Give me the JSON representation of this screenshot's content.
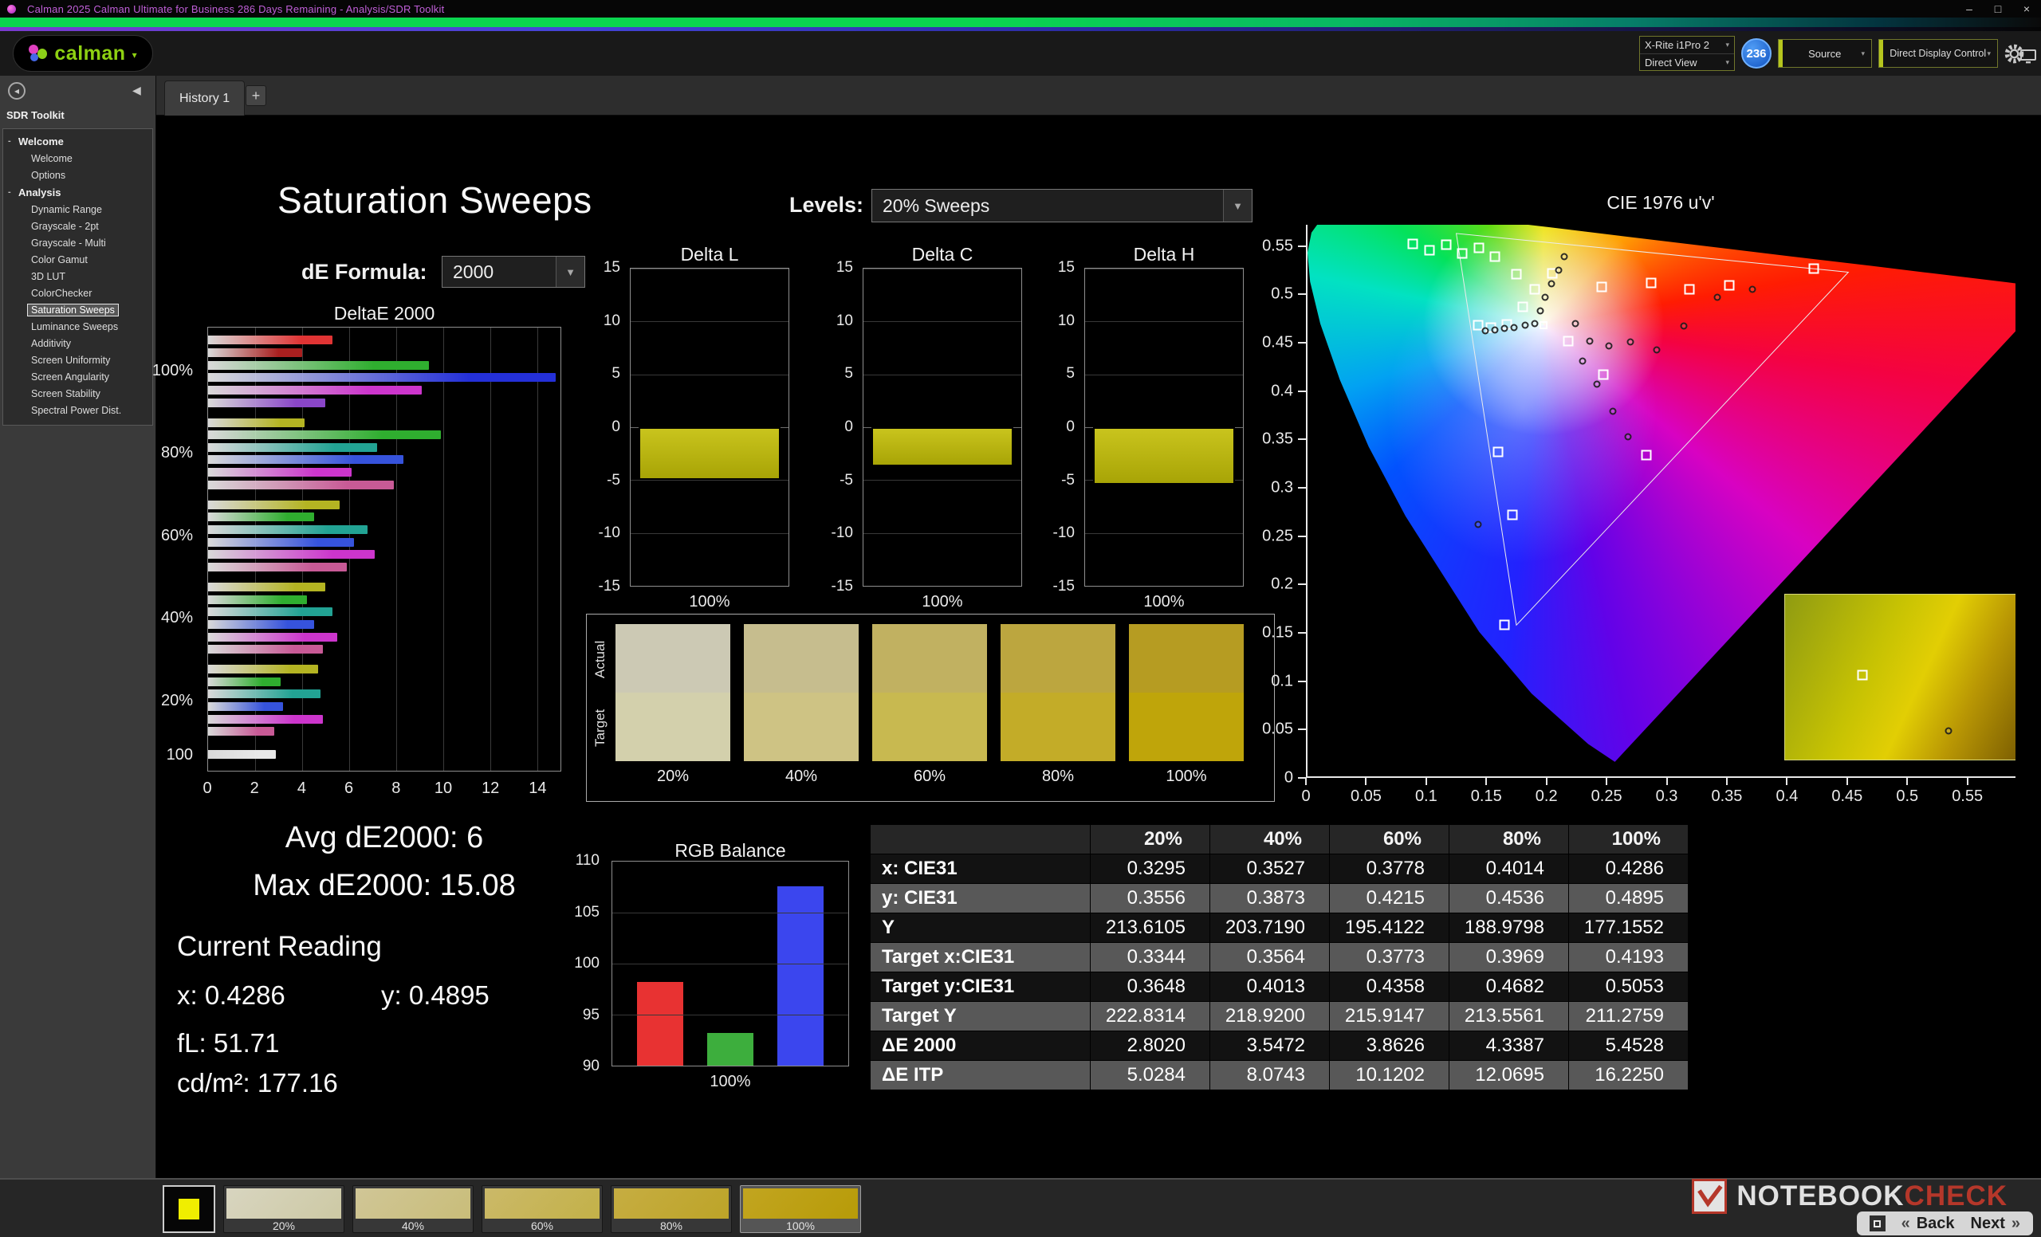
{
  "titlebar": {
    "title": "Calman 2025 Calman Ultimate for Business 286 Days Remaining  - Analysis/SDR Toolkit",
    "minimize": "–",
    "maximize": "□",
    "close": "×"
  },
  "icons": {
    "caret_down": "▼",
    "caret_small": "▾",
    "collapse_left": "◀",
    "plus": "+",
    "tree_expander": "-",
    "menu_dot": "◂",
    "back_arrow": "«",
    "next_arrow": "»"
  },
  "brand": {
    "name": "calman"
  },
  "toolbar": {
    "meter_line1": "X-Rite i1Pro 2",
    "meter_line2": "Direct View",
    "badge": "236",
    "source_label": "Source",
    "display_label": "Direct Display Control"
  },
  "tabs": {
    "history": "History 1"
  },
  "sidebar": {
    "title": "SDR Toolkit",
    "selected": "Saturation Sweeps",
    "groups": [
      {
        "label": "Welcome",
        "items": [
          "Welcome",
          "Options"
        ]
      },
      {
        "label": "Analysis",
        "items": [
          "Dynamic Range",
          "Grayscale - 2pt",
          "Grayscale - Multi",
          "Color Gamut",
          "3D LUT",
          "ColorChecker",
          "Saturation Sweeps",
          "Luminance Sweeps",
          "Additivity",
          "Screen Uniformity",
          "Screen Angularity",
          "Screen Stability",
          "Spectral Power Dist."
        ]
      }
    ]
  },
  "page": {
    "title": "Saturation Sweeps",
    "levels_label": "Levels:",
    "levels_value": "20% Sweeps",
    "formula_label": "dE Formula:",
    "formula_value": "2000"
  },
  "chart_data": [
    {
      "name": "deltae_2000",
      "type": "bar",
      "orientation": "horizontal",
      "title": "DeltaE 2000",
      "xlim": [
        0,
        15
      ],
      "xticks": [
        0,
        2,
        4,
        6,
        8,
        10,
        12,
        14
      ],
      "groups": [
        {
          "label": "100%",
          "bars": [
            {
              "color": "#e03434",
              "value": 5.3
            },
            {
              "color": "#aa1f1f",
              "value": 4.0
            },
            {
              "color": "#2fae2f",
              "value": 9.4
            },
            {
              "color": "#2430d8",
              "value": 14.8
            },
            {
              "color": "#cc35cc",
              "value": 9.1
            },
            {
              "color": "#8a46c8",
              "value": 5.0
            }
          ]
        },
        {
          "label": "80%",
          "bars": [
            {
              "color": "#b4b422",
              "value": 4.1
            },
            {
              "color": "#2fae2f",
              "value": 9.9
            },
            {
              "color": "#22a394",
              "value": 7.2
            },
            {
              "color": "#3653dc",
              "value": 8.3
            },
            {
              "color": "#cc35cc",
              "value": 6.1
            },
            {
              "color": "#c85a96",
              "value": 7.9
            }
          ]
        },
        {
          "label": "60%",
          "bars": [
            {
              "color": "#b4b422",
              "value": 5.6
            },
            {
              "color": "#2fae2f",
              "value": 4.5
            },
            {
              "color": "#22a394",
              "value": 6.8
            },
            {
              "color": "#3653dc",
              "value": 6.2
            },
            {
              "color": "#cc35cc",
              "value": 7.1
            },
            {
              "color": "#c85a96",
              "value": 5.9
            }
          ]
        },
        {
          "label": "40%",
          "bars": [
            {
              "color": "#b4b422",
              "value": 5.0
            },
            {
              "color": "#2fae2f",
              "value": 4.2
            },
            {
              "color": "#22a394",
              "value": 5.3
            },
            {
              "color": "#3653dc",
              "value": 4.5
            },
            {
              "color": "#cc35cc",
              "value": 5.5
            },
            {
              "color": "#c85a96",
              "value": 4.9
            }
          ]
        },
        {
          "label": "20%",
          "bars": [
            {
              "color": "#b4b422",
              "value": 4.7
            },
            {
              "color": "#2fae2f",
              "value": 3.1
            },
            {
              "color": "#22a394",
              "value": 4.8
            },
            {
              "color": "#3653dc",
              "value": 3.2
            },
            {
              "color": "#cc35cc",
              "value": 4.9
            },
            {
              "color": "#c85a96",
              "value": 2.8
            }
          ]
        },
        {
          "label": "100",
          "bars": [
            {
              "color": "#e8e8e8",
              "value": 2.9
            }
          ]
        }
      ]
    },
    {
      "name": "delta_l",
      "type": "bar",
      "title": "Delta L",
      "ylim": [
        -15,
        15
      ],
      "yticks": [
        15,
        10,
        5,
        0,
        -5,
        -10,
        -15
      ],
      "xlabel": "100%",
      "value": -5.0,
      "bar_color": "#c9c41d"
    },
    {
      "name": "delta_c",
      "type": "bar",
      "title": "Delta C",
      "ylim": [
        -15,
        15
      ],
      "yticks": [
        15,
        10,
        5,
        0,
        -5,
        -10,
        -15
      ],
      "xlabel": "100%",
      "value": -3.7,
      "bar_color": "#c9c41d"
    },
    {
      "name": "delta_h",
      "type": "bar",
      "title": "Delta H",
      "ylim": [
        -15,
        15
      ],
      "yticks": [
        15,
        10,
        5,
        0,
        -5,
        -10,
        -15
      ],
      "xlabel": "100%",
      "value": -5.4,
      "bar_color": "#c9c41d"
    },
    {
      "name": "rgb_balance",
      "type": "bar",
      "title": "RGB Balance",
      "ylim": [
        90,
        110
      ],
      "yticks": [
        110,
        105,
        100,
        95,
        90
      ],
      "xlabel": "100%",
      "series": [
        {
          "name": "Red",
          "value": 98.2,
          "color": "#e83232"
        },
        {
          "name": "Green",
          "value": 93.2,
          "color": "#3dae3d"
        },
        {
          "name": "Blue",
          "value": 107.6,
          "color": "#3b46ee"
        }
      ]
    },
    {
      "name": "cie_1976",
      "type": "scatter",
      "title": "CIE 1976 u'v'",
      "xlim": [
        0,
        0.59
      ],
      "ylim": [
        0,
        0.572
      ],
      "tick_step": 0.05,
      "tick_max": 0.55,
      "white_point": [
        0.1978,
        0.4683
      ],
      "gamut_triangle": [
        [
          0.451,
          0.523
        ],
        [
          0.125,
          0.563
        ],
        [
          0.175,
          0.158
        ]
      ],
      "targets": [
        [
          0.089,
          0.552
        ],
        [
          0.103,
          0.546
        ],
        [
          0.117,
          0.551
        ],
        [
          0.13,
          0.542
        ],
        [
          0.144,
          0.548
        ],
        [
          0.157,
          0.539
        ],
        [
          0.175,
          0.521
        ],
        [
          0.205,
          0.522
        ],
        [
          0.246,
          0.508
        ],
        [
          0.287,
          0.512
        ],
        [
          0.319,
          0.505
        ],
        [
          0.352,
          0.509
        ],
        [
          0.422,
          0.527
        ],
        [
          0.143,
          0.468
        ],
        [
          0.154,
          0.466
        ],
        [
          0.167,
          0.469
        ],
        [
          0.18,
          0.487
        ],
        [
          0.19,
          0.505
        ],
        [
          0.218,
          0.452
        ],
        [
          0.247,
          0.417
        ],
        [
          0.283,
          0.334
        ],
        [
          0.16,
          0.337
        ],
        [
          0.172,
          0.272
        ],
        [
          0.165,
          0.158
        ],
        [
          0.463,
          0.106
        ]
      ],
      "measurements": [
        [
          0.149,
          0.462
        ],
        [
          0.157,
          0.463
        ],
        [
          0.165,
          0.465
        ],
        [
          0.173,
          0.466
        ],
        [
          0.182,
          0.468
        ],
        [
          0.19,
          0.47
        ],
        [
          0.195,
          0.483
        ],
        [
          0.199,
          0.497
        ],
        [
          0.204,
          0.511
        ],
        [
          0.21,
          0.525
        ],
        [
          0.215,
          0.539
        ],
        [
          0.224,
          0.47
        ],
        [
          0.236,
          0.452
        ],
        [
          0.252,
          0.447
        ],
        [
          0.27,
          0.451
        ],
        [
          0.292,
          0.443
        ],
        [
          0.314,
          0.467
        ],
        [
          0.342,
          0.497
        ],
        [
          0.371,
          0.505
        ],
        [
          0.23,
          0.431
        ],
        [
          0.242,
          0.407
        ],
        [
          0.255,
          0.379
        ],
        [
          0.268,
          0.353
        ],
        [
          0.143,
          0.262
        ],
        [
          0.534,
          0.049
        ]
      ],
      "preview_box": {
        "u": [
          0.398,
          0.592
        ],
        "v": [
          0.018,
          0.19
        ]
      }
    }
  ],
  "swatches": {
    "row_labels": [
      "Actual",
      "Target"
    ],
    "items": [
      {
        "label": "20%",
        "actual": "#ccc9b4",
        "target": "#d3d0ac"
      },
      {
        "label": "40%",
        "actual": "#c6bd8e",
        "target": "#cec384"
      },
      {
        "label": "60%",
        "actual": "#c1b161",
        "target": "#c8b950"
      },
      {
        "label": "80%",
        "actual": "#bca63f",
        "target": "#c3ac28"
      },
      {
        "label": "100%",
        "actual": "#b69c22",
        "target": "#bfa50a"
      }
    ]
  },
  "readings": {
    "avg": "Avg dE2000: 6",
    "max": "Max dE2000: 15.08",
    "current_label": "Current Reading",
    "x": "x: 0.4286",
    "y": "y: 0.4895",
    "fl": "fL: 51.71",
    "cd": "cd/m²: 177.16"
  },
  "table": {
    "columns": [
      "",
      "20%",
      "40%",
      "60%",
      "80%",
      "100%"
    ],
    "rows": [
      {
        "label": "x: CIE31",
        "values": [
          "0.3295",
          "0.3527",
          "0.3778",
          "0.4014",
          "0.4286"
        ]
      },
      {
        "label": "y: CIE31",
        "values": [
          "0.3556",
          "0.3873",
          "0.4215",
          "0.4536",
          "0.4895"
        ]
      },
      {
        "label": "Y",
        "values": [
          "213.6105",
          "203.7190",
          "195.4122",
          "188.9798",
          "177.1552"
        ]
      },
      {
        "label": "Target x:CIE31",
        "values": [
          "0.3344",
          "0.3564",
          "0.3773",
          "0.3969",
          "0.4193"
        ]
      },
      {
        "label": "Target y:CIE31",
        "values": [
          "0.3648",
          "0.4013",
          "0.4358",
          "0.4682",
          "0.5053"
        ]
      },
      {
        "label": "Target Y",
        "values": [
          "222.8314",
          "218.9200",
          "215.9147",
          "213.5561",
          "211.2759"
        ]
      },
      {
        "label": "ΔE 2000",
        "values": [
          "2.8020",
          "3.5472",
          "3.8626",
          "4.3387",
          "5.4528"
        ]
      },
      {
        "label": "ΔE ITP",
        "values": [
          "5.0284",
          "8.0743",
          "10.1202",
          "12.0695",
          "16.2250"
        ]
      }
    ]
  },
  "filmstrip": {
    "items": [
      {
        "label": "20%",
        "c1": "#d8d5c0",
        "c2": "#cdc9a4",
        "active": false
      },
      {
        "label": "40%",
        "c1": "#d0c697",
        "c2": "#c9bd79",
        "active": false
      },
      {
        "label": "60%",
        "c1": "#cbb969",
        "c2": "#c3b148",
        "active": false
      },
      {
        "label": "80%",
        "c1": "#c6ad42",
        "c2": "#bda428",
        "active": false
      },
      {
        "label": "100%",
        "c1": "#c2a520",
        "c2": "#b79b08",
        "active": true
      }
    ]
  },
  "watermark": {
    "word1": "NOTEBOOK",
    "word2": "CHECK"
  },
  "nav": {
    "back": "Back",
    "next": "Next"
  }
}
